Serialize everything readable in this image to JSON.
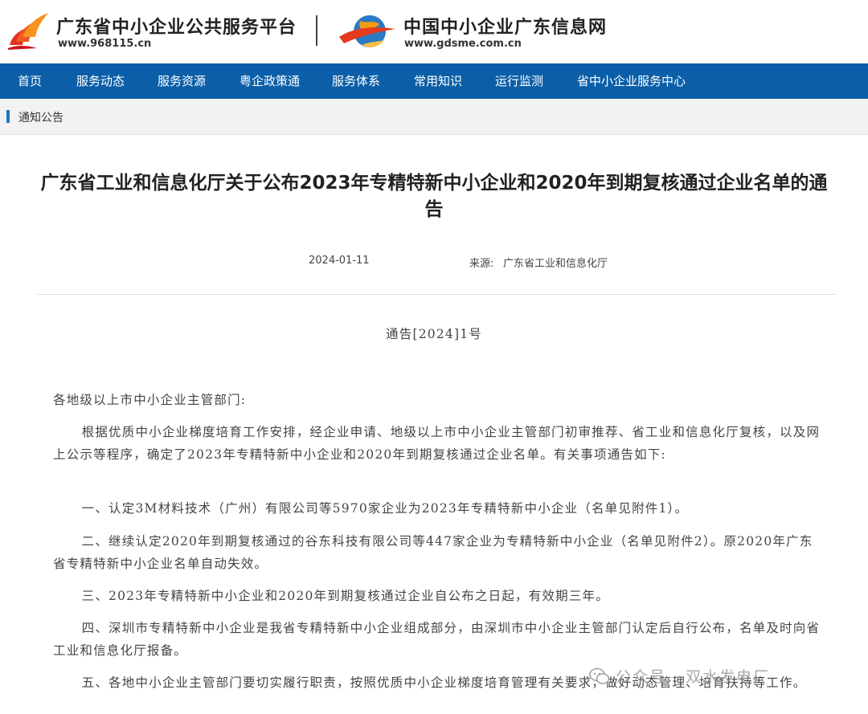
{
  "header": {
    "site1": {
      "title": "广东省中小企业公共服务平台",
      "url": "www.968115.cn"
    },
    "site2": {
      "title": "中国中小企业广东信息网",
      "url": "www.gdsme.com.cn"
    }
  },
  "nav": {
    "items": [
      {
        "label": "首页"
      },
      {
        "label": "服务动态"
      },
      {
        "label": "服务资源"
      },
      {
        "label": "粤企政策通"
      },
      {
        "label": "服务体系"
      },
      {
        "label": "常用知识"
      },
      {
        "label": "运行监测"
      },
      {
        "label": "省中小企业服务中心"
      }
    ]
  },
  "breadcrumb": {
    "label": "通知公告"
  },
  "article": {
    "title": "广东省工业和信息化厅关于公布2023年专精特新中小企业和2020年到期复核通过企业名单的通告",
    "date": "2024-01-11",
    "source_label": "来源:",
    "source": "广东省工业和信息化厅",
    "doc_number": "通告[2024]1号",
    "paragraphs": [
      "各地级以上市中小企业主管部门:",
      "根据优质中小企业梯度培育工作安排，经企业申请、地级以上市中小企业主管部门初审推荐、省工业和信息化厅复核，以及网上公示等程序，确定了2023年专精特新中小企业和2020年到期复核通过企业名单。有关事项通告如下:",
      "一、认定3M材料技术（广州）有限公司等5970家企业为2023年专精特新中小企业（名单见附件1）。",
      "二、继续认定2020年到期复核通过的谷东科技有限公司等447家企业为专精特新中小企业（名单见附件2）。原2020年广东省专精特新中小企业名单自动失效。",
      "三、2023年专精特新中小企业和2020年到期复核通过企业自公布之日起，有效期三年。",
      "四、深圳市专精特新中小企业是我省专精特新中小企业组成部分，由深圳市中小企业主管部门认定后自行公布，名单及时向省工业和信息化厅报备。",
      "五、各地中小企业主管部门要切实履行职责，按照优质中小企业梯度培育管理有关要求，做好动态管理、培育扶持等工作。"
    ]
  },
  "watermark": {
    "text": "公众号 · 双水发电厂"
  },
  "colors": {
    "nav_bg": "#0b5fa8",
    "accent": "#1a78c2"
  }
}
